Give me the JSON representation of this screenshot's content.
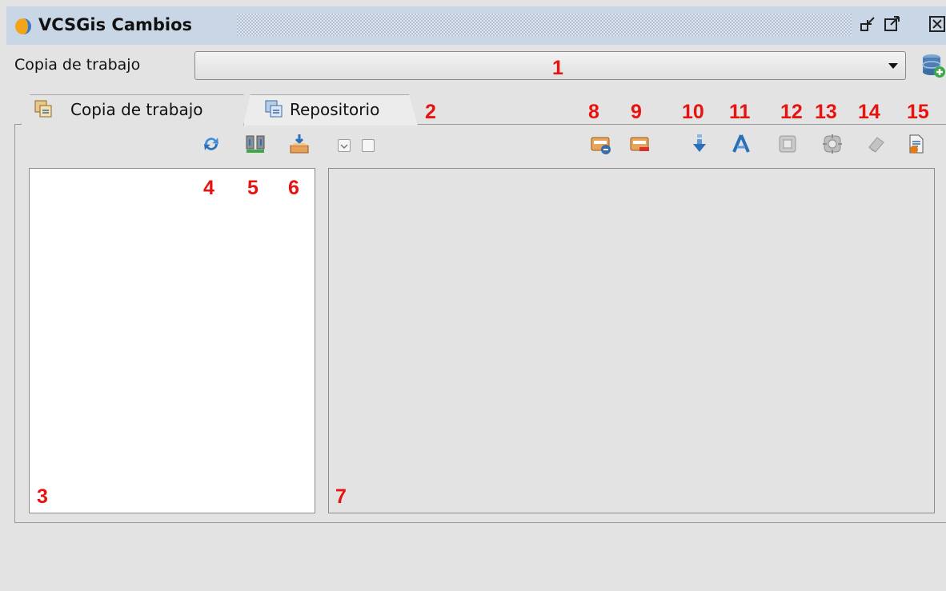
{
  "window": {
    "title": "VCSGis Cambios",
    "icons": [
      "app-logo-icon",
      "minimize-icon",
      "maximize-icon",
      "close-icon"
    ]
  },
  "working_copy": {
    "label": "Copia de trabajo",
    "selected_value": "",
    "add_icon": "database-add-icon"
  },
  "tabs": [
    {
      "label": "Copia de trabajo",
      "icon": "working-copy-tab-icon",
      "active": false
    },
    {
      "label": "Repositorio",
      "icon": "repository-tab-icon",
      "active": true
    }
  ],
  "toolbar_icons": {
    "left": [
      "refresh-icon",
      "download-changes-icon",
      "import-icon"
    ],
    "right": [
      "show-changes-icon",
      "remove-changes-icon",
      "update-icon",
      "merge-icon",
      "select-all-icon",
      "zoom-icon",
      "eraser-icon",
      "report-icon"
    ]
  },
  "callouts": {
    "c1": "1",
    "c2": "2",
    "c3": "3",
    "c4": "4",
    "c5": "5",
    "c6": "6",
    "c7": "7",
    "c8": "8",
    "c9": "9",
    "c10": "10",
    "c11": "11",
    "c12": "12",
    "c13": "13",
    "c14": "14",
    "c15": "15"
  },
  "colors": {
    "title_bar": "#c9d6e6",
    "callout": "#e8130e",
    "background": "#e3e3e3"
  }
}
